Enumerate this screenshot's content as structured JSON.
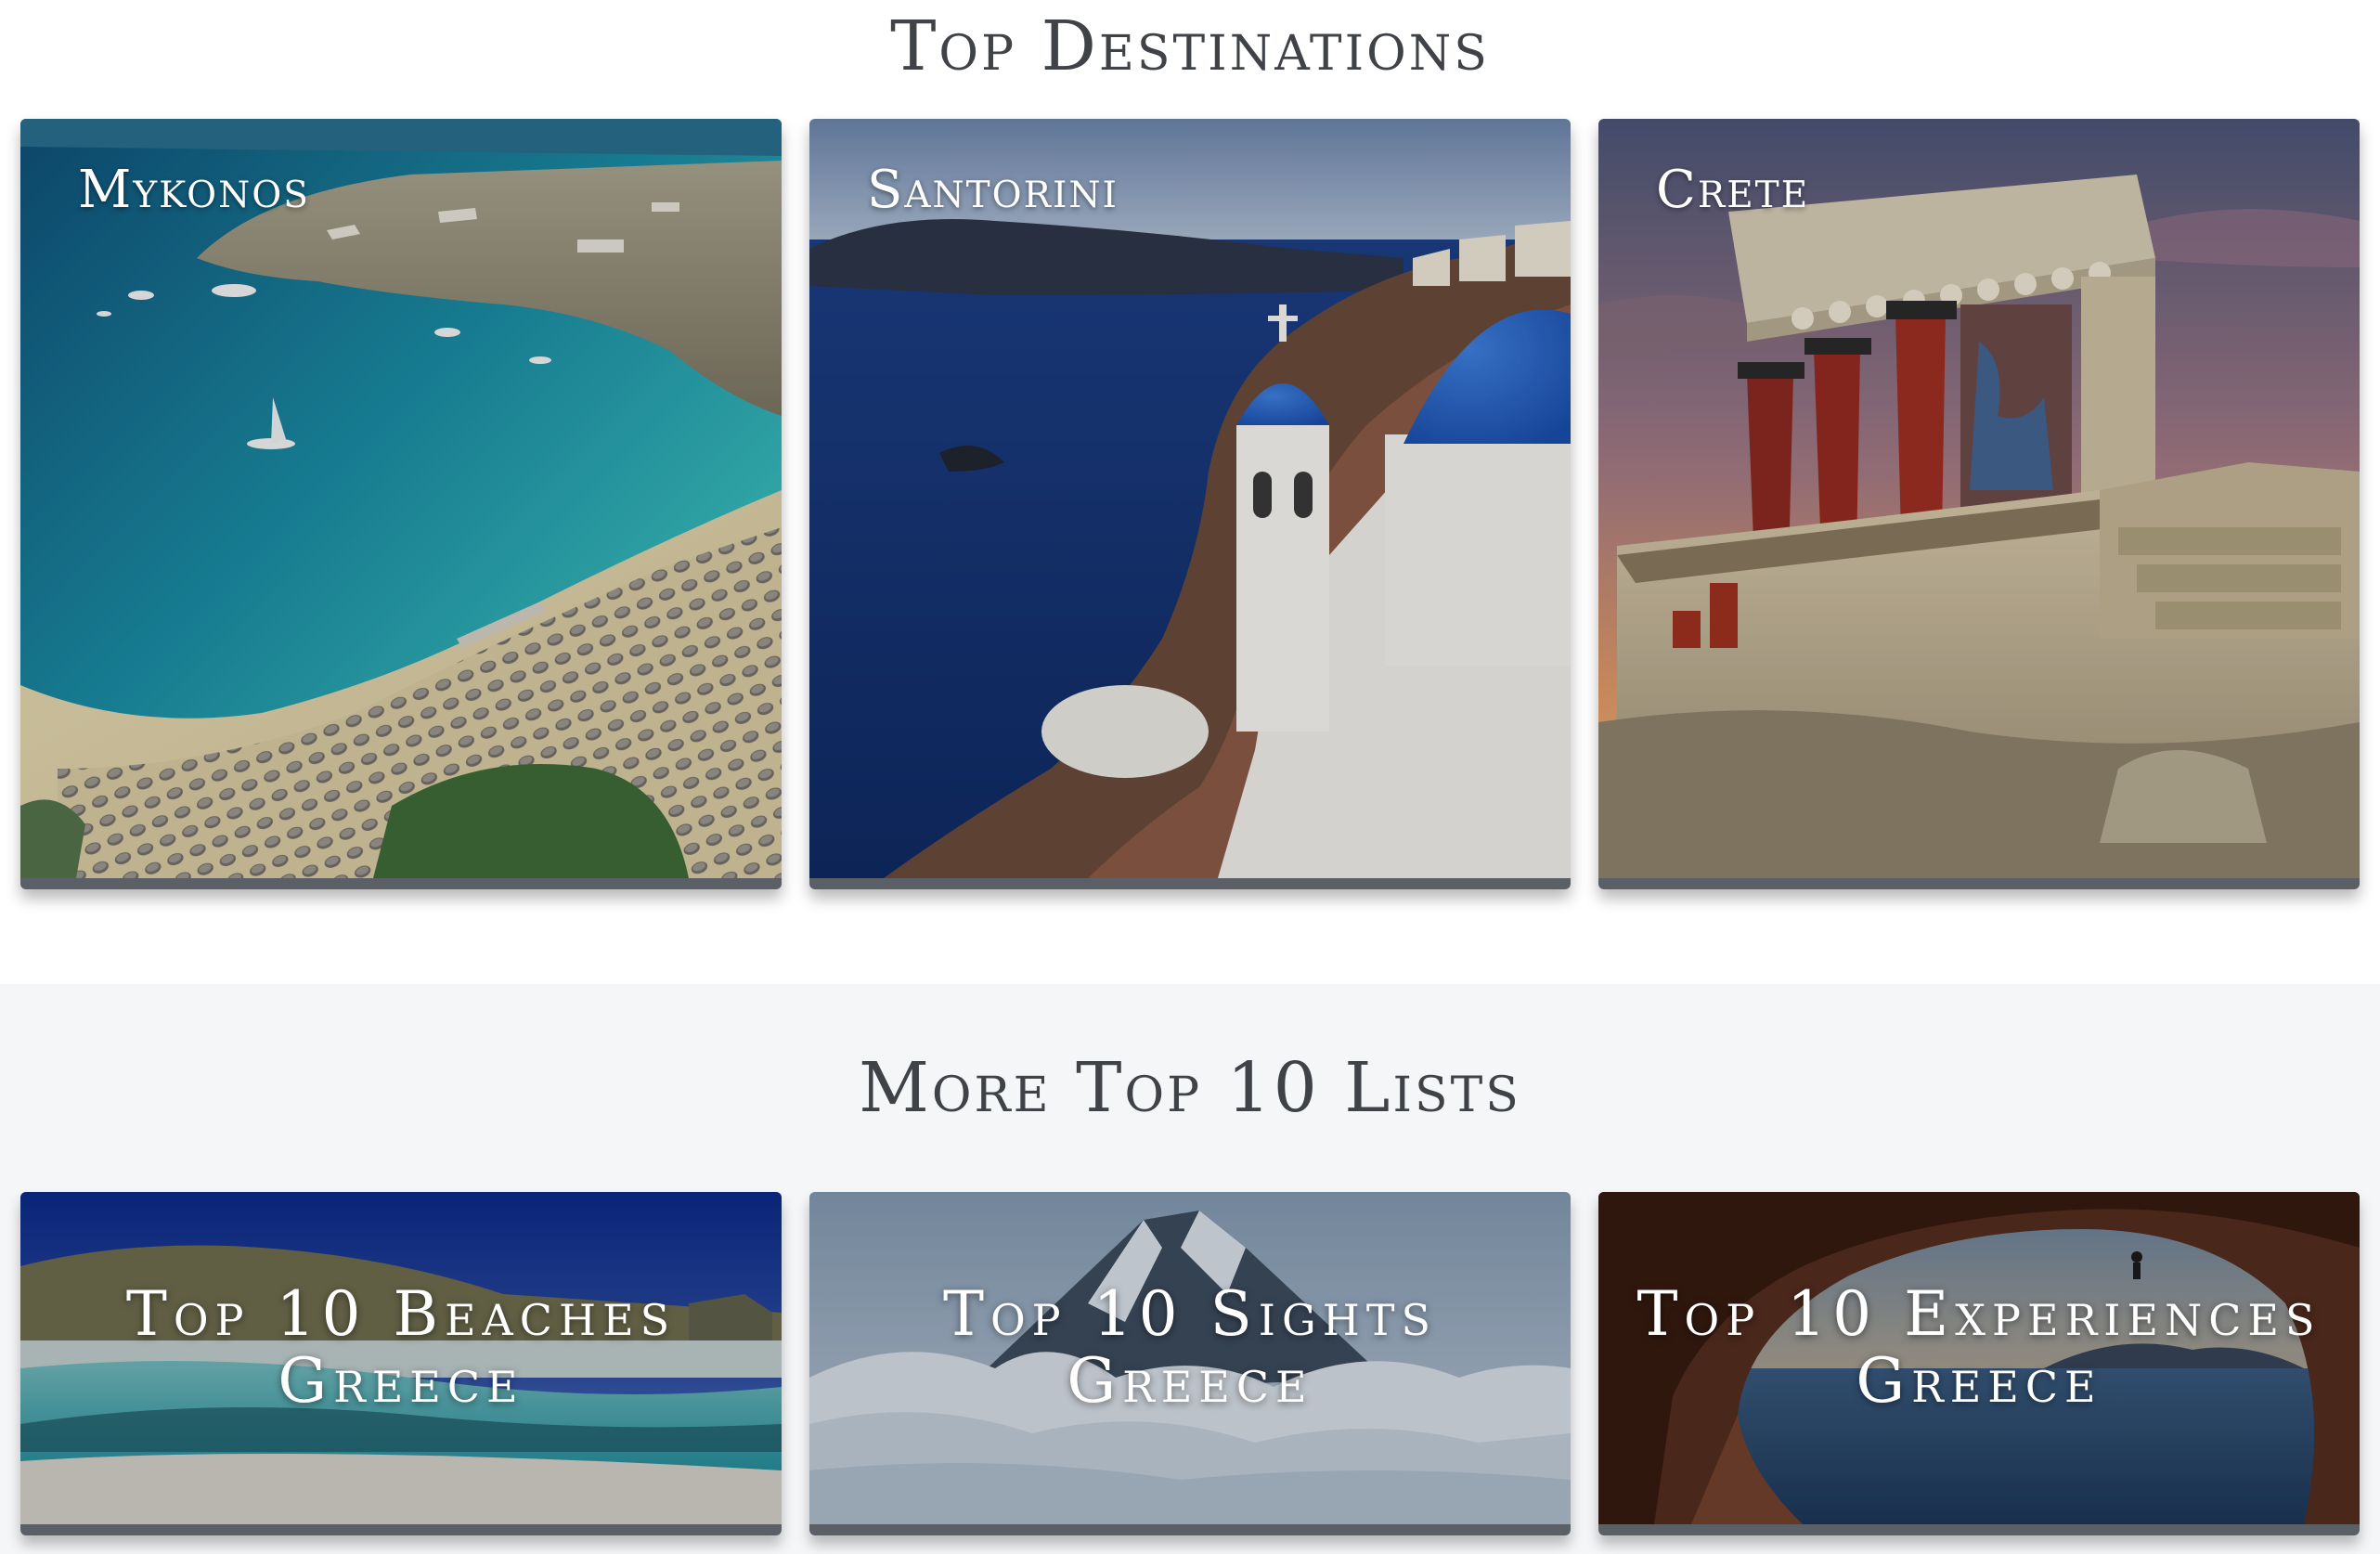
{
  "top_destinations": {
    "heading": "Top Destinations",
    "cards": [
      {
        "label": "Mykonos",
        "image": "mykonos-beach-aerial"
      },
      {
        "label": "Santorini",
        "image": "santorini-blue-domes"
      },
      {
        "label": "Crete",
        "image": "knossos-palace-ruins"
      }
    ]
  },
  "more_lists": {
    "heading": "More Top 10 Lists",
    "cards": [
      {
        "line1": "Top 10 Beaches",
        "line2": "Greece",
        "image": "balos-lagoon-beach"
      },
      {
        "line1": "Top 10 Sights",
        "line2": "Greece",
        "image": "mountain-above-clouds"
      },
      {
        "line1": "Top 10 Experiences",
        "line2": "Greece",
        "image": "sea-cave-climber"
      }
    ]
  },
  "colors": {
    "heading_text": "#3f4347",
    "card_footer": "#5b5f66",
    "section_more_background": "#f5f6f8"
  }
}
